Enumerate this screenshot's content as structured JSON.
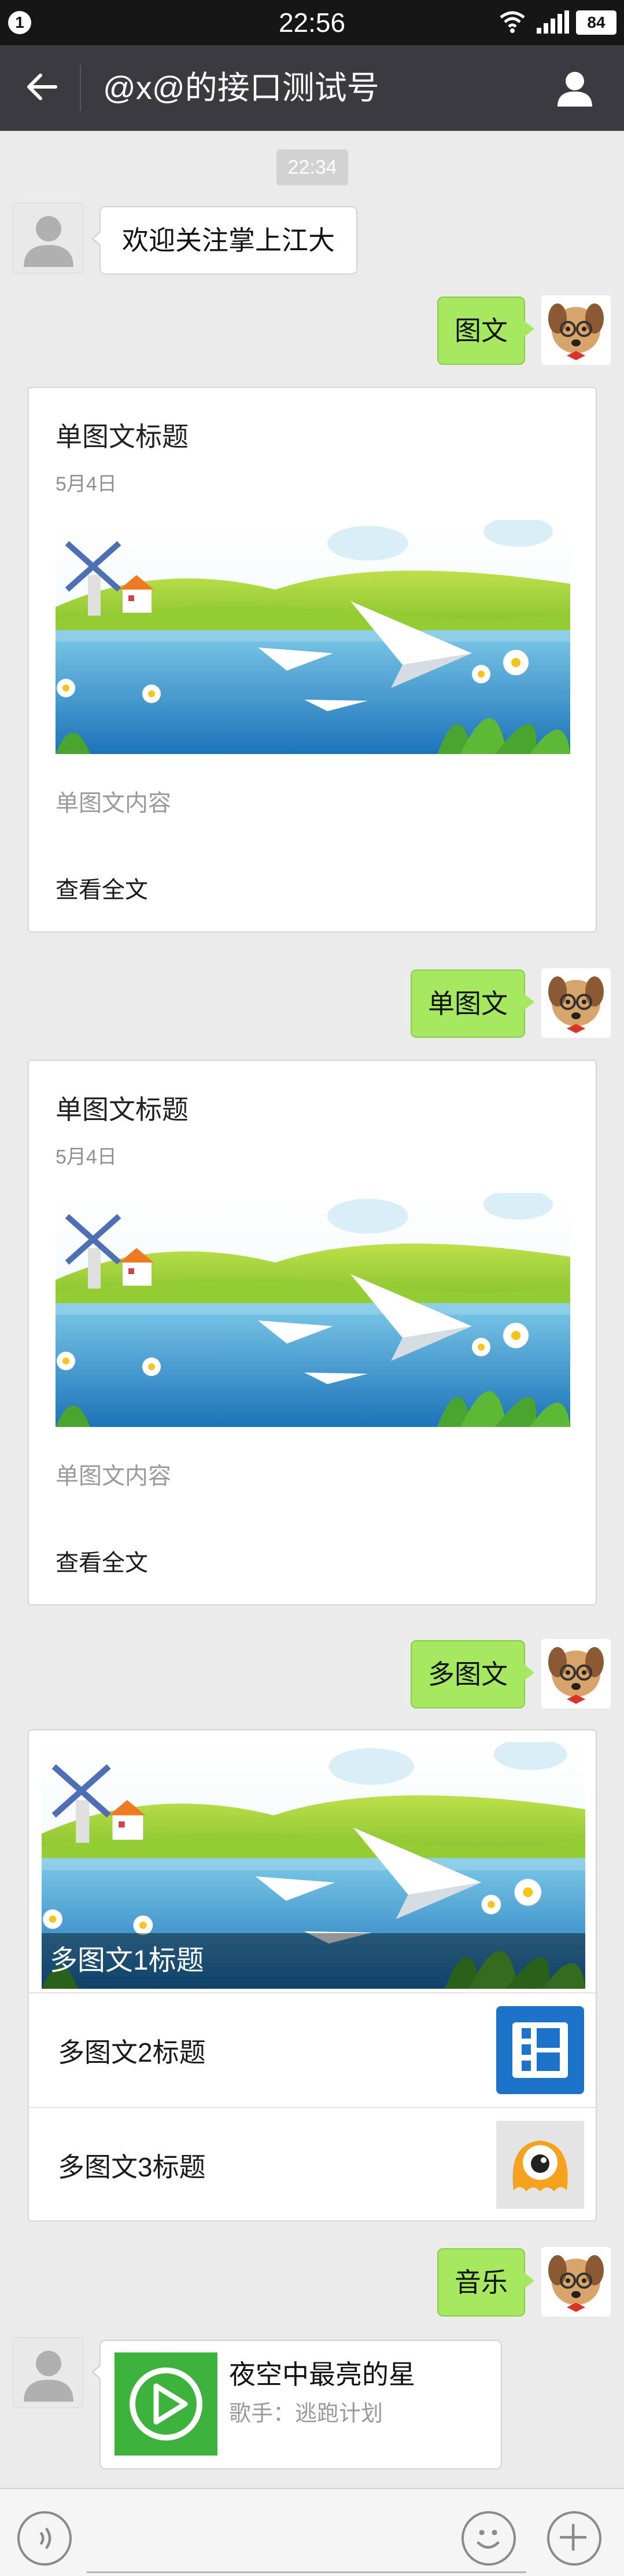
{
  "status_bar": {
    "notification_count": "1",
    "time": "22:56",
    "battery": "84"
  },
  "header": {
    "title": "@x@的接口测试号",
    "back_icon": "arrow-left-icon",
    "profile_icon": "person-icon"
  },
  "timestamp": "22:34",
  "messages": {
    "welcome": "欢迎关注掌上江大",
    "user_1": "图文",
    "user_2": "单图文",
    "user_3": "多图文",
    "user_4": "音乐"
  },
  "single_article_1": {
    "title": "单图文标题",
    "date": "5月4日",
    "desc": "单图文内容",
    "read_more": "查看全文"
  },
  "single_article_2": {
    "title": "单图文标题",
    "date": "5月4日",
    "desc": "单图文内容",
    "read_more": "查看全文"
  },
  "multi_article": {
    "cover_title": "多图文1标题",
    "items": [
      {
        "title": "多图文2标题",
        "thumb_icon": "film-icon"
      },
      {
        "title": "多图文3标题",
        "thumb_icon": "one-eyed-monster-icon"
      }
    ]
  },
  "music": {
    "title": "夜空中最亮的星",
    "artist": "歌手：逃跑计划",
    "icon": "play-icon"
  },
  "colors": {
    "nav_bg": "#3a3a3f",
    "bubble_green": "#a6e860",
    "chat_bg": "#ebebeb"
  }
}
